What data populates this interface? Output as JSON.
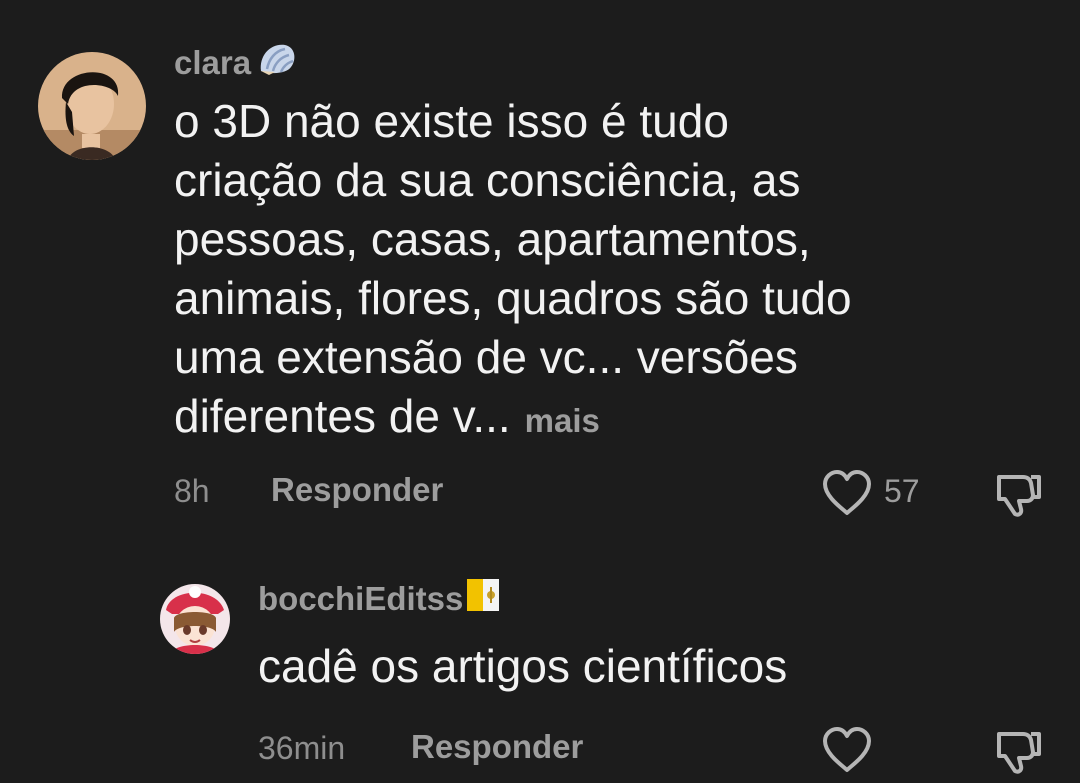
{
  "comments": [
    {
      "username": "clara",
      "badge_icon": "seashell-icon",
      "lines": [
        "o 3D não existe isso é tudo",
        "criação da sua consciência, as",
        "pessoas, casas, apartamentos,",
        "animais, flores, quadros são tudo",
        "uma extensão de vc... versões",
        "diferentes de v..."
      ],
      "more_label": "mais",
      "time": "8h",
      "reply_label": "Responder",
      "like_count": "57"
    },
    {
      "username": "bocchiEditss",
      "badge_icon": "vatican-flag-icon",
      "text": "cadê os artigos científicos",
      "time": "36min",
      "reply_label": "Responder"
    }
  ],
  "colors": {
    "background": "#1c1c1c",
    "primary_text": "#f2f2f2",
    "secondary_text": "#9d9d9d"
  }
}
